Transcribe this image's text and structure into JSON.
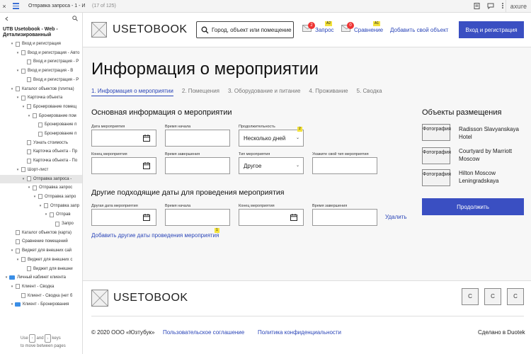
{
  "topbar": {
    "close_glyph": "×",
    "page_title": "Отправка запроса - 1 - Ин...",
    "page_count": "(17 of 125)",
    "brand": "axure",
    "tools": [
      "page-icon",
      "comment-icon",
      "more-icon"
    ]
  },
  "sidebar": {
    "project": "UTB Usetobook - Web - Детализированный",
    "hint_prefix": "Use",
    "hint_and": "and",
    "hint_suffix": "keys",
    "hint_line2": "to move between pages",
    "items": [
      {
        "label": "Вход и регистрация",
        "indent": 1,
        "type": "page",
        "toggle": "▾"
      },
      {
        "label": "Вход и регистрация - Авто",
        "indent": 2,
        "type": "page",
        "toggle": "▾"
      },
      {
        "label": "Вход и регистрация - Р",
        "indent": 3,
        "type": "page",
        "toggle": ""
      },
      {
        "label": "Вход и регистрация - В",
        "indent": 2,
        "type": "page",
        "toggle": "▾"
      },
      {
        "label": "Вход и регистрация - Р",
        "indent": 3,
        "type": "page",
        "toggle": ""
      },
      {
        "label": "Каталог объектов (плитка)",
        "indent": 1,
        "type": "page",
        "toggle": "▾"
      },
      {
        "label": "Карточка объекта",
        "indent": 2,
        "type": "page",
        "toggle": "▾"
      },
      {
        "label": "Бронирование помещ",
        "indent": 3,
        "type": "page",
        "toggle": "▾"
      },
      {
        "label": "Бронирование пом",
        "indent": 4,
        "type": "page",
        "toggle": "▾"
      },
      {
        "label": "Бронирование п",
        "indent": 5,
        "type": "page",
        "toggle": ""
      },
      {
        "label": "Бронирование п",
        "indent": 5,
        "type": "page",
        "toggle": ""
      },
      {
        "label": "Узнать стоимость",
        "indent": 3,
        "type": "page",
        "toggle": ""
      },
      {
        "label": "Карточка объекта - Пр",
        "indent": 3,
        "type": "page",
        "toggle": ""
      },
      {
        "label": "Карточка объекта - По",
        "indent": 3,
        "type": "page",
        "toggle": ""
      },
      {
        "label": "Шорт-лист",
        "indent": 2,
        "type": "page",
        "toggle": "▾"
      },
      {
        "label": "Отправка запроса -",
        "indent": 3,
        "type": "page",
        "toggle": "▾",
        "selected": true
      },
      {
        "label": "Отправка запрос",
        "indent": 4,
        "type": "page",
        "toggle": "▾"
      },
      {
        "label": "Отправка запро",
        "indent": 5,
        "type": "page",
        "toggle": "▾"
      },
      {
        "label": "Отправка запр",
        "indent": 6,
        "type": "page",
        "toggle": "▾"
      },
      {
        "label": "Отправ",
        "indent": 7,
        "type": "page",
        "toggle": "▾"
      },
      {
        "label": "Запро",
        "indent": 8,
        "type": "page",
        "toggle": ""
      },
      {
        "label": "Каталог объектов (карта)",
        "indent": 1,
        "type": "page",
        "toggle": ""
      },
      {
        "label": "Сравнение помещений",
        "indent": 1,
        "type": "page",
        "toggle": ""
      },
      {
        "label": "Виджет для внешних сай",
        "indent": 1,
        "type": "page",
        "toggle": "▾"
      },
      {
        "label": "Виджет для внешних с",
        "indent": 2,
        "type": "page",
        "toggle": "▾"
      },
      {
        "label": "Виджет для внешни",
        "indent": 3,
        "type": "page",
        "toggle": ""
      },
      {
        "label": "Личный кабинет клиента",
        "indent": 0,
        "type": "folder",
        "toggle": "▾"
      },
      {
        "label": "Клиент - Сводка",
        "indent": 1,
        "type": "page",
        "toggle": "▾"
      },
      {
        "label": "Клиент - Сводка (нет б",
        "indent": 2,
        "type": "page",
        "toggle": ""
      },
      {
        "label": "Клиент - Бронирования",
        "indent": 1,
        "type": "folder",
        "toggle": "▾"
      }
    ]
  },
  "header": {
    "brand": "USETOBOOK",
    "search_placeholder": "Город, объект или помещение",
    "request": {
      "label": "Запрос",
      "count": "2",
      "tag": "A2"
    },
    "compare": {
      "label": "Сравнение",
      "count": "0",
      "tag": "A1"
    },
    "add_object": "Добавить свой объект",
    "login": "Вход и регистрация"
  },
  "page": {
    "title": "Информация о мероприятии",
    "steps": [
      "1. Информация о мероприятии",
      "2. Помещения",
      "3. Оборудование и питание",
      "4. Проживание",
      "5. Сводка"
    ],
    "active_step": 0
  },
  "event_form": {
    "section_title": "Основная информация о мероприятии",
    "start_date_label": "Дата мероприятия",
    "start_time_label": "Время начала",
    "duration_label": "Продолжительность",
    "duration_value": "Несколько дней",
    "duration_badge": "2",
    "end_date_label": "Конец мероприятия",
    "end_time_label": "Время завершения",
    "type_label": "Тип мероприятия",
    "type_value": "Другое",
    "custom_type_label": "Укажите свой тип мероприятия"
  },
  "alt_dates": {
    "section_title": "Другие подходящие даты для проведения мероприятия",
    "date_label": "Другая дата мероприятия",
    "start_time_label": "Время начала",
    "end_label": "Конец мероприятия",
    "end_time_label": "Время завершения",
    "delete_link": "Удалить",
    "add_link": "Добавить другие даты проведения мероприятия",
    "add_badge": "1"
  },
  "hotels": {
    "title": "Объекты размещения",
    "photo_label": "Фотография",
    "items": [
      {
        "name": "Radisson Slavyanskaya Hotel"
      },
      {
        "name": "Courtyard by Marriott Moscow"
      },
      {
        "name": "Hilton Moscow Leningradskaya"
      }
    ],
    "cta": "Продолжить"
  },
  "footer": {
    "brand": "USETOBOOK",
    "social": [
      "С",
      "С",
      "С"
    ],
    "copyright": "© 2020 ООО «Юзтубук»",
    "terms": "Пользовательское соглашение",
    "privacy": "Политика конфиденциальности",
    "made_by": "Сделано в Duotek"
  }
}
